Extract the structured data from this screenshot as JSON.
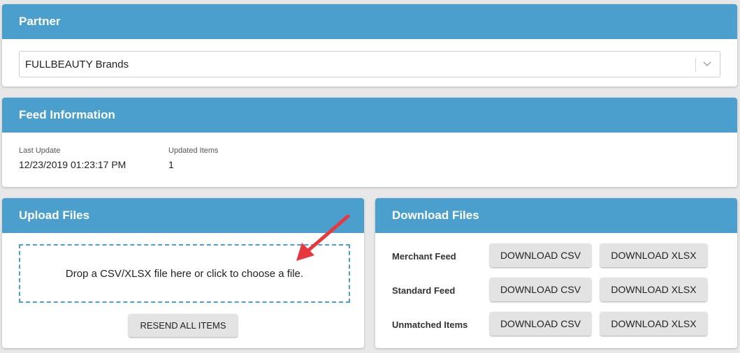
{
  "partner": {
    "title": "Partner",
    "selected_value": "FULLBEAUTY Brands"
  },
  "feed_info": {
    "title": "Feed Information",
    "last_update_label": "Last Update",
    "last_update_value": "12/23/2019 01:23:17 PM",
    "updated_items_label": "Updated Items",
    "updated_items_value": "1"
  },
  "upload": {
    "title": "Upload Files",
    "dropzone_text": "Drop a CSV/XLSX file here or click to choose a file.",
    "resend_label": "RESEND ALL ITEMS"
  },
  "download": {
    "title": "Download Files",
    "rows": [
      {
        "label": "Merchant Feed",
        "csv": "DOWNLOAD CSV",
        "xlsx": "DOWNLOAD XLSX"
      },
      {
        "label": "Standard Feed",
        "csv": "DOWNLOAD CSV",
        "xlsx": "DOWNLOAD XLSX"
      },
      {
        "label": "Unmatched Items",
        "csv": "DOWNLOAD CSV",
        "xlsx": "DOWNLOAD XLSX"
      }
    ]
  },
  "icons": {
    "select_chevron": "chevron-down-icon",
    "annotation": "red-arrow-icon"
  },
  "colors": {
    "header_blue": "#4a9fcd",
    "annotation_red": "#e8383d",
    "button_gray": "#e3e3e3"
  }
}
